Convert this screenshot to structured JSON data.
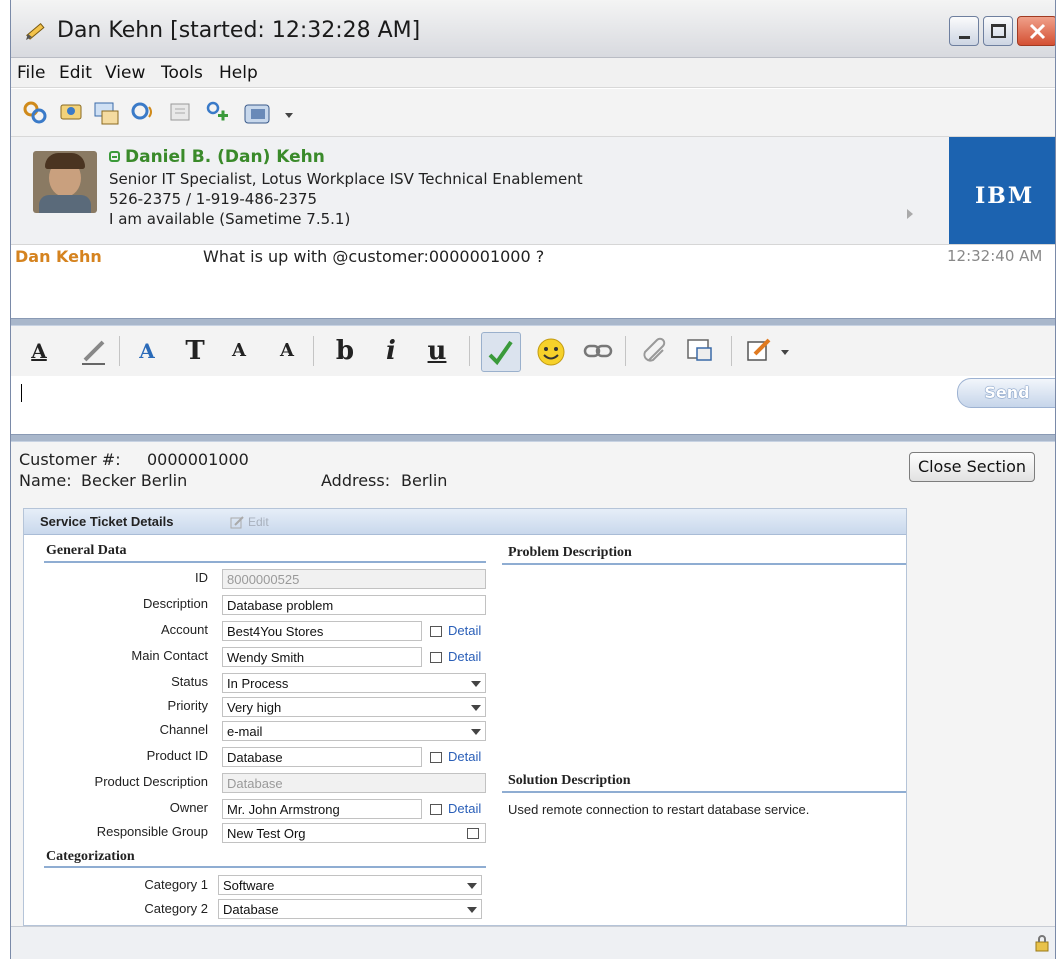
{
  "window": {
    "title": "Dan Kehn [started: 12:32:28 AM]"
  },
  "menu": [
    "File",
    "Edit",
    "View",
    "Tools",
    "Help"
  ],
  "contact": {
    "name": "Daniel B. (Dan) Kehn",
    "title": "Senior IT Specialist, Lotus Workplace ISV Technical Enablement",
    "phone": "526-2375 / 1-919-486-2375",
    "status": "I am available  (Sametime 7.5.1)",
    "company_logo": "IBM",
    "status_color": "#3a8a2a"
  },
  "chat": {
    "sender": "Dan Kehn",
    "message": "What is up with @customer:0000001000 ?",
    "time": "12:32:40 AM"
  },
  "compose": {
    "send_label": "Send",
    "value": ""
  },
  "customer": {
    "number_label": "Customer #:",
    "number": "0000001000",
    "name_label": "Name:",
    "name": "Becker Berlin",
    "address_label": "Address:",
    "address": "Berlin",
    "close_label": "Close Section"
  },
  "ticket": {
    "header": "Service Ticket Details",
    "edit_label": "Edit",
    "general_title": "General Data",
    "problem_title": "Problem Description",
    "solution_title": "Solution Description",
    "solution_text": "Used remote connection to restart database service.",
    "categorization_title": "Categorization",
    "detail_label": "Detail",
    "fields": {
      "id": {
        "label": "ID",
        "value": "8000000525"
      },
      "description": {
        "label": "Description",
        "value": "Database problem"
      },
      "account": {
        "label": "Account",
        "value": "Best4You Stores"
      },
      "main_contact": {
        "label": "Main Contact",
        "value": "Wendy Smith"
      },
      "status": {
        "label": "Status",
        "value": "In Process"
      },
      "priority": {
        "label": "Priority",
        "value": "Very high"
      },
      "channel": {
        "label": "Channel",
        "value": "e-mail"
      },
      "product_id": {
        "label": "Product ID",
        "value": "Database"
      },
      "product_description": {
        "label": "Product Description",
        "value": "Database"
      },
      "owner": {
        "label": "Owner",
        "value": "Mr. John Armstrong"
      },
      "responsible_group": {
        "label": "Responsible Group",
        "value": "New Test Org"
      },
      "category1": {
        "label": "Category 1",
        "value": "Software"
      },
      "category2": {
        "label": "Category 2",
        "value": "Database"
      }
    }
  },
  "colors": {
    "accent": "#1c63b0",
    "sender": "#d5831f",
    "link": "#2a5fb8"
  }
}
